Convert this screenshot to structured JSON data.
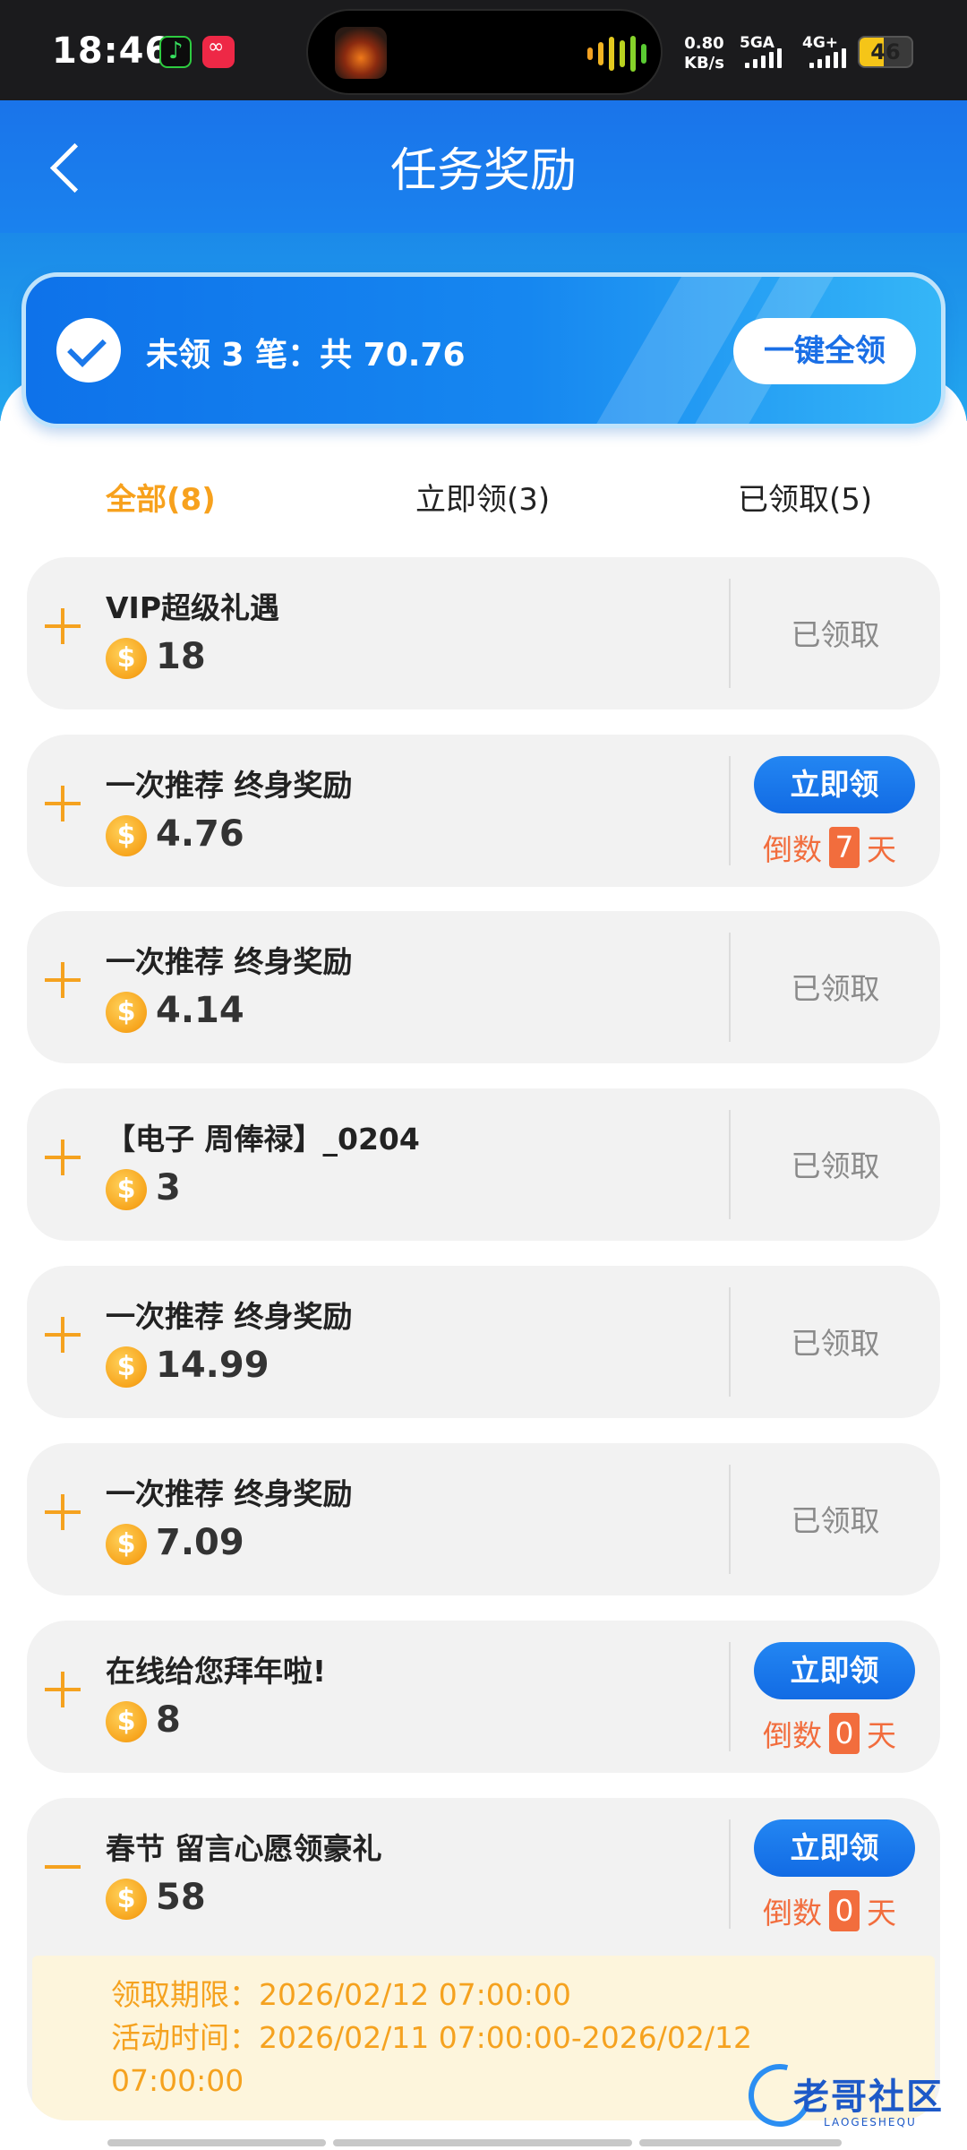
{
  "status_bar": {
    "time": "18:46",
    "net_speed_value": "0.80",
    "net_speed_unit": "KB/s",
    "sim1_label": "5GA",
    "sim2_label": "4G+",
    "battery_level": "46",
    "battery_color": "#f5c518"
  },
  "header": {
    "title": "任务奖励",
    "back_icon": "chevron-left-icon"
  },
  "summary": {
    "text": "未领 3 笔：共 70.76",
    "claim_all_label": "一键全领"
  },
  "tabs": [
    {
      "label": "全部(8)",
      "active": true
    },
    {
      "label": "立即领(3)",
      "active": false
    },
    {
      "label": "已领取(5)",
      "active": false
    }
  ],
  "items": [
    {
      "name": "VIP超级礼遇",
      "coin_symbol": "$",
      "amount": "18",
      "status": "已领取"
    },
    {
      "name": "一次推荐 终身奖励",
      "coin_symbol": "$",
      "amount": "4.76",
      "claim_label": "立即领",
      "countdown_prefix": "倒数",
      "countdown_days": "7",
      "countdown_suffix": "天"
    },
    {
      "name": "一次推荐 终身奖励",
      "coin_symbol": "$",
      "amount": "4.14",
      "status": "已领取"
    },
    {
      "name": "【电子 周俸禄】_0204",
      "coin_symbol": "$",
      "amount": "3",
      "status": "已领取"
    },
    {
      "name": "一次推荐 终身奖励",
      "coin_symbol": "$",
      "amount": "14.99",
      "status": "已领取"
    },
    {
      "name": "一次推荐 终身奖励",
      "coin_symbol": "$",
      "amount": "7.09",
      "status": "已领取"
    },
    {
      "name": "在线给您拜年啦!",
      "coin_symbol": "$",
      "amount": "8",
      "claim_label": "立即领",
      "countdown_prefix": "倒数",
      "countdown_days": "0",
      "countdown_suffix": "天"
    },
    {
      "name": "春节 留言心愿领豪礼",
      "coin_symbol": "$",
      "amount": "58",
      "claim_label": "立即领",
      "countdown_prefix": "倒数",
      "countdown_days": "0",
      "countdown_suffix": "天",
      "detail_line1": "领取期限：2026/02/12 07:00:00",
      "detail_line2": "活动时间：2026/02/11 07:00:00-2026/02/12",
      "detail_line3": "07:00:00"
    }
  ],
  "watermark": {
    "text": "老哥社区",
    "sub": "LAOGESHEQU"
  },
  "colors": {
    "accent_blue": "#1a74ea",
    "accent_orange": "#f5a21f",
    "countdown_red": "#f26d3d"
  }
}
